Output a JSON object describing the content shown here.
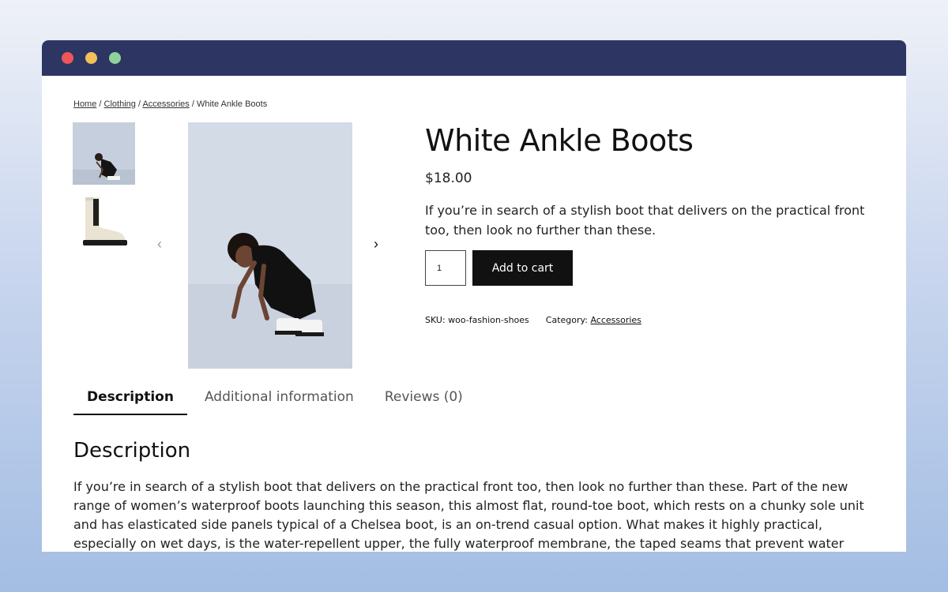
{
  "window": {
    "controls": [
      "close",
      "minimize",
      "maximize"
    ]
  },
  "breadcrumb": {
    "items": [
      "Home",
      "Clothing",
      "Accessories"
    ],
    "separator": "/",
    "current": "White Ankle Boots"
  },
  "gallery": {
    "thumbnails": [
      "woman-crouching-thumbnail",
      "white-boot-thumbnail"
    ],
    "main_image": "woman-crouching-in-boots",
    "prev_icon": "chevron-left-icon",
    "next_icon": "chevron-right-icon"
  },
  "product": {
    "title": "White Ankle Boots",
    "price": "$18.00",
    "short_description": "If you’re in search of a stylish boot that delivers on the practical front too, then look no further than these.",
    "quantity": "1",
    "add_to_cart_label": "Add to cart",
    "sku_label": "SKU:",
    "sku_value": "woo-fashion-shoes",
    "category_label": "Category:",
    "category_value": "Accessories"
  },
  "tabs": [
    {
      "label": "Description",
      "active": true
    },
    {
      "label": "Additional information",
      "active": false
    },
    {
      "label": "Reviews (0)",
      "active": false
    }
  ],
  "description": {
    "heading": "Description",
    "body": "If you’re in search of a stylish boot that delivers on the practical front too, then look no further than these. Part of the new range of women’s waterproof boots launching this season, this almost flat, round-toe boot, which rests on a chunky sole unit and has elasticated side panels typical of a Chelsea boot, is an on-trend casual option. What makes it highly practical, especially on wet days, is the water-repellent upper, the fully waterproof membrane, the taped seams that prevent water from penetrating the"
  },
  "colors": {
    "titlebar": "#2d3563",
    "button": "#111111",
    "close_dot": "#f0555a",
    "minimize_dot": "#f2c15c",
    "maximize_dot": "#8fd39b"
  }
}
